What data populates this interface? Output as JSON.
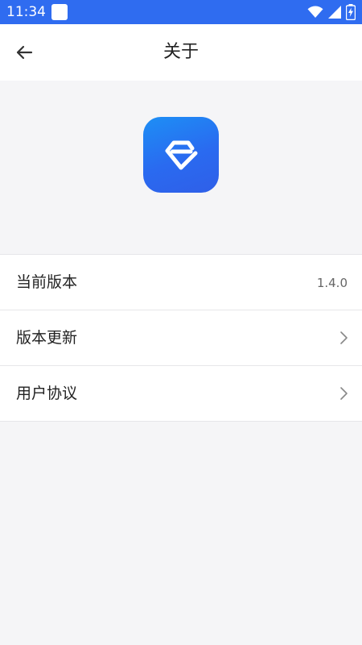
{
  "status_bar": {
    "time": "11:34",
    "background": "#2f6cf0",
    "icons": [
      "notification-square-icon",
      "wifi-icon",
      "signal-icon",
      "battery-charging-icon"
    ]
  },
  "header": {
    "back_icon": "arrow-left-icon",
    "title": "关于"
  },
  "logo": {
    "icon": "app-logo-icon",
    "colors": [
      "#1d8ff5",
      "#2f5fe8"
    ]
  },
  "list": {
    "items": [
      {
        "label": "当前版本",
        "value": "1.4.0"
      },
      {
        "label": "版本更新",
        "icon": "chevron-right-icon"
      },
      {
        "label": "用户协议",
        "icon": "chevron-right-icon"
      }
    ]
  },
  "colors": {
    "accent": "#2f6cf0",
    "page_background": "#f5f5f7",
    "divider": "#e6e6e9",
    "text_primary": "#222222",
    "text_secondary": "#666666"
  }
}
